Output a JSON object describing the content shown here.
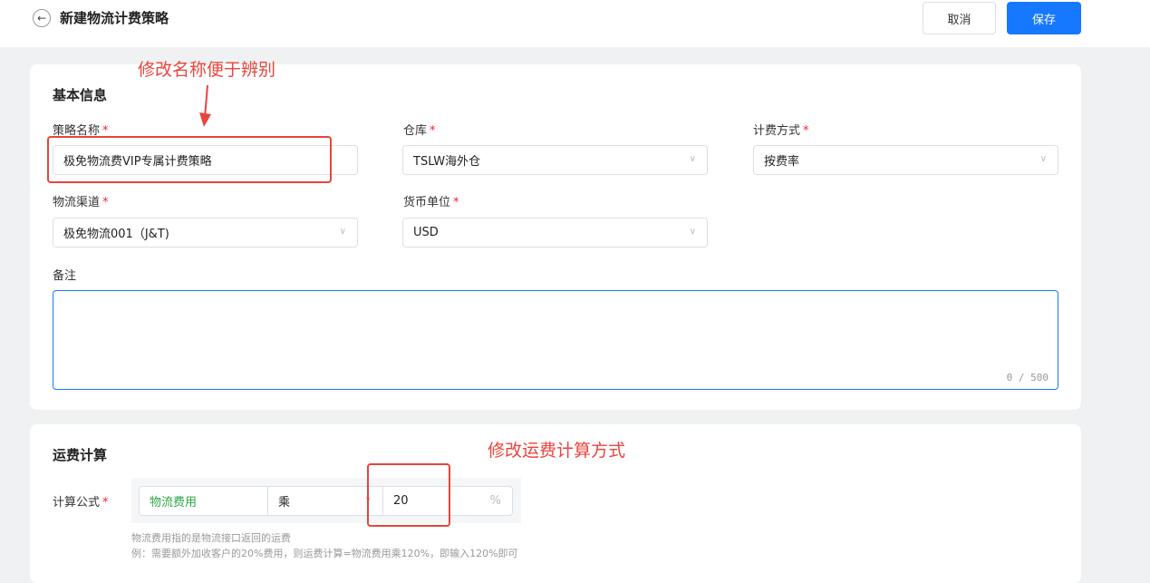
{
  "header": {
    "back_icon": "arrow-left-icon",
    "title": "新建物流计费策略",
    "cancel_label": "取消",
    "save_label": "保存"
  },
  "basic_info": {
    "section_title": "基本信息",
    "strategy_name": {
      "label": "策略名称",
      "value": "极免物流费VIP专属计费策略"
    },
    "warehouse": {
      "label": "仓库",
      "value": "TSLW海外仓"
    },
    "billing_method": {
      "label": "计费方式",
      "value": "按费率"
    },
    "logistics_channel": {
      "label": "物流渠道",
      "value": "极免物流001（J&T)"
    },
    "currency": {
      "label": "货币单位",
      "value": "USD"
    },
    "remark": {
      "label": "备注",
      "counter": "0 / 500"
    },
    "required_mark": "*"
  },
  "freight_calc": {
    "section_title": "运费计算",
    "formula_label": "计算公式",
    "base_item": "物流费用",
    "operator": "乘",
    "factor_value": "20",
    "unit": "%",
    "hint_line1": "物流费用指的是物流接口返回的运费",
    "hint_line2": "例：需要额外加收客户的20%费用，则运费计算=物流费用乘120%，即输入120%即可",
    "base_item_color": "#2aa745"
  },
  "annotations": {
    "name_note": "修改名称便于辨别",
    "calc_note": "修改运费计算方式",
    "color": "#e8453c"
  }
}
